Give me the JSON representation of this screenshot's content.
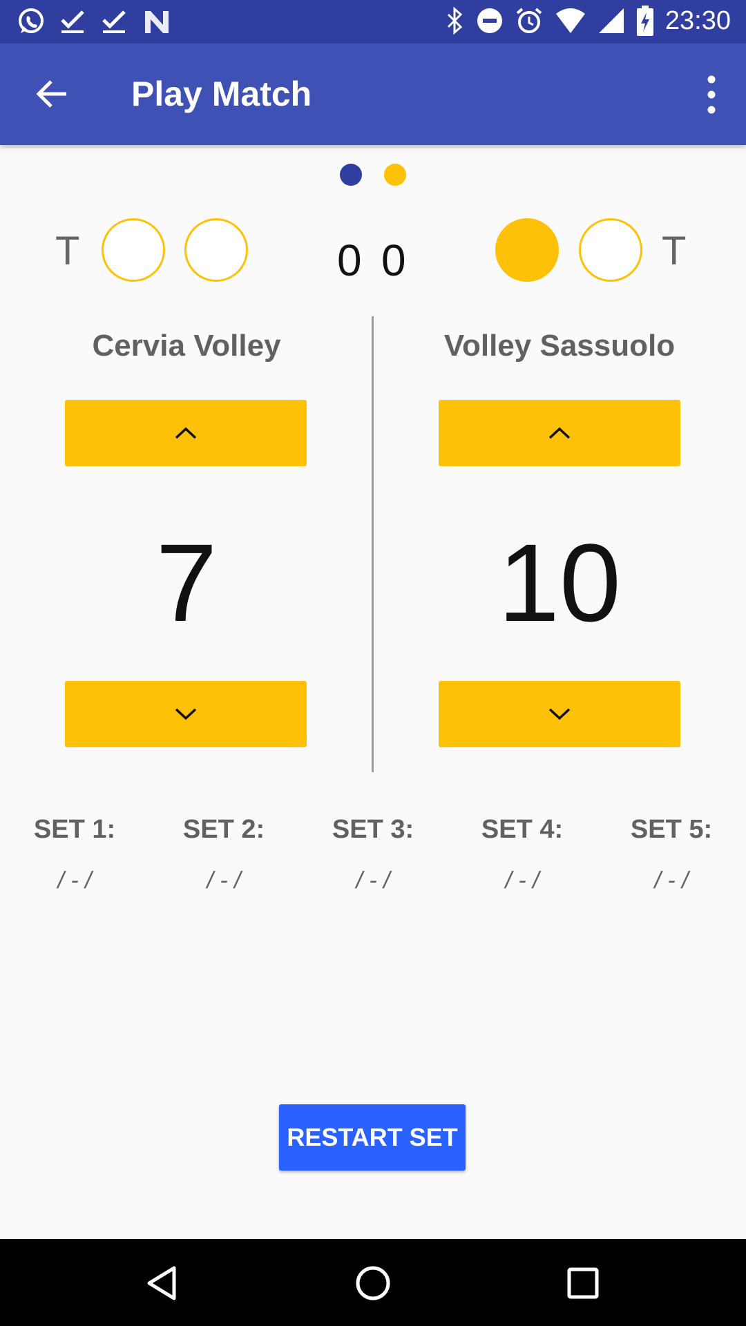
{
  "status_bar": {
    "time": "23:30",
    "left_icons": [
      "whatsapp-icon",
      "check-icon",
      "check-icon",
      "n-logo-icon"
    ],
    "right_icons": [
      "bluetooth-icon",
      "do-not-disturb-icon",
      "alarm-icon",
      "wifi-icon",
      "signal-icon",
      "battery-charging-icon"
    ]
  },
  "app_bar": {
    "title": "Play Match",
    "back_icon": "arrow-back-icon",
    "menu_icon": "more-vert-icon"
  },
  "page_indicator": {
    "count": 2,
    "active_index": 0
  },
  "timeouts": {
    "label_left": "T",
    "label_right": "T",
    "home_used": [
      false,
      false
    ],
    "away_used": [
      true,
      false
    ]
  },
  "sets_won": {
    "home": "0",
    "away": "0"
  },
  "teams": {
    "home": {
      "name": "Cervia Volley",
      "score": "7"
    },
    "away": {
      "name": "Volley Sassuolo",
      "score": "10"
    }
  },
  "sets": [
    {
      "label": "SET 1:",
      "value": "/ - /"
    },
    {
      "label": "SET 2:",
      "value": "/ - /"
    },
    {
      "label": "SET 3:",
      "value": "/ - /"
    },
    {
      "label": "SET 4:",
      "value": "/ - /"
    },
    {
      "label": "SET 5:",
      "value": "/ - /"
    }
  ],
  "restart_button": "RESTART SET",
  "colors": {
    "primary": "#3f51b5",
    "primary_dark": "#303f9f",
    "accent": "#ffc107",
    "button_blue": "#2962ff"
  },
  "nav_bar": [
    "back-triangle-icon",
    "home-circle-icon",
    "recents-square-icon"
  ]
}
